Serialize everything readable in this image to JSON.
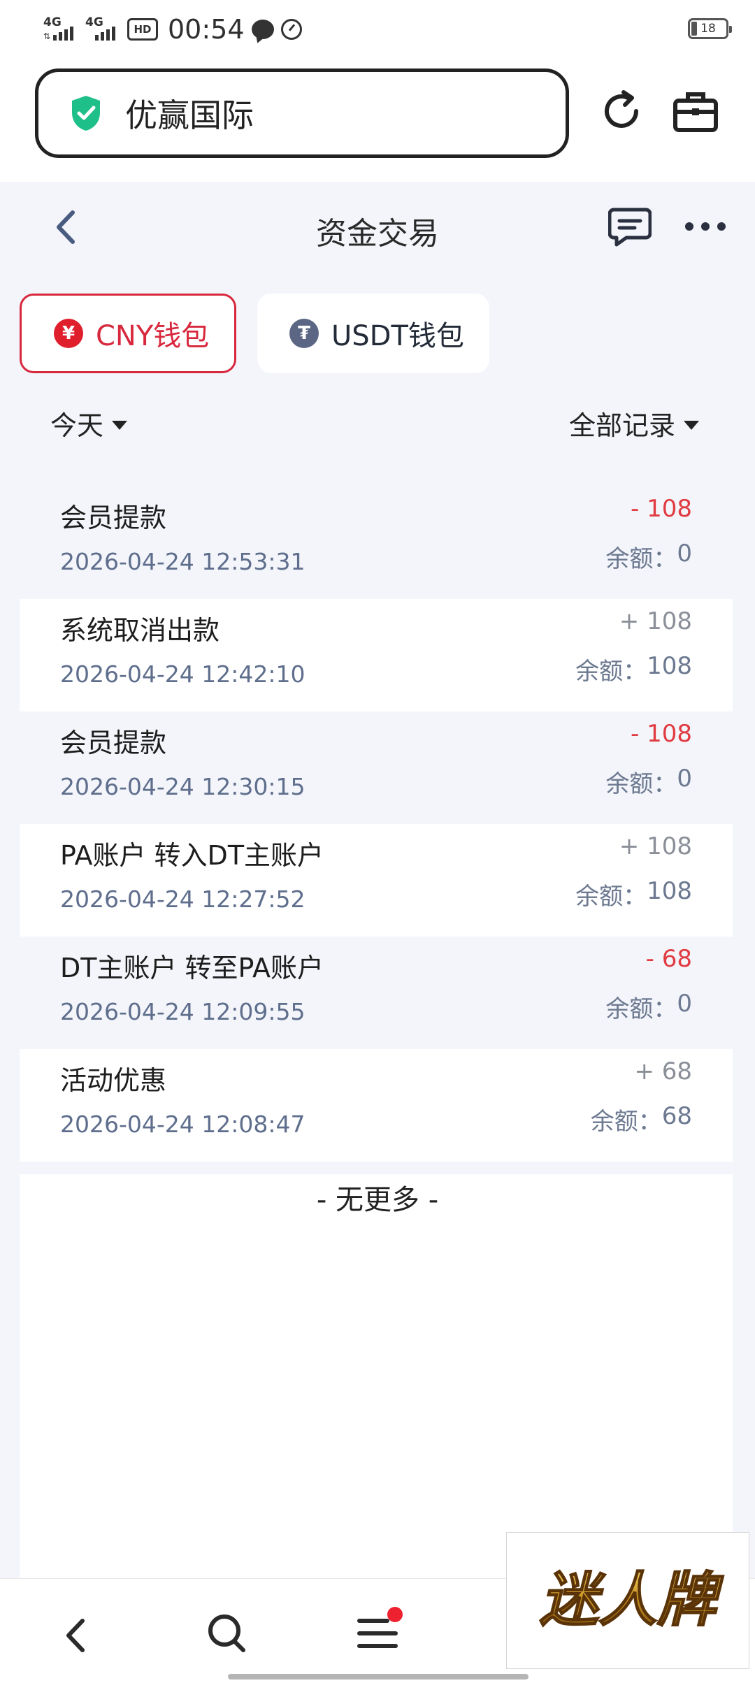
{
  "status_bar": {
    "signal1": "4G",
    "signal2": "4G",
    "hd": "HD",
    "time": "00:54",
    "battery": "18"
  },
  "browser": {
    "url_title": "优赢国际"
  },
  "header": {
    "title": "资金交易"
  },
  "wallet_tabs": [
    {
      "label": "CNY钱包",
      "coin_symbol": "¥",
      "active": true
    },
    {
      "label": "USDT钱包",
      "coin_symbol": "₮",
      "active": false
    }
  ],
  "filters": {
    "date": "今天",
    "type": "全部记录"
  },
  "balance_label": "余额：",
  "transactions": [
    {
      "name": "会员提款",
      "time": "2026-04-24 12:53:31",
      "amount": "- 108",
      "balance": "0",
      "sign": "neg"
    },
    {
      "name": "系统取消出款",
      "time": "2026-04-24 12:42:10",
      "amount": "+ 108",
      "balance": "108",
      "sign": "pos"
    },
    {
      "name": "会员提款",
      "time": "2026-04-24 12:30:15",
      "amount": "- 108",
      "balance": "0",
      "sign": "neg"
    },
    {
      "name": "PA账户 转入DT主账户",
      "time": "2026-04-24 12:27:52",
      "amount": "+ 108",
      "balance": "108",
      "sign": "pos"
    },
    {
      "name": "DT主账户 转至PA账户",
      "time": "2026-04-24 12:09:55",
      "amount": "- 68",
      "balance": "0",
      "sign": "neg"
    },
    {
      "name": "活动优惠",
      "time": "2026-04-24 12:08:47",
      "amount": "+ 68",
      "balance": "68",
      "sign": "pos"
    }
  ],
  "list_end": "- 无更多 -",
  "watermark": "迷人牌",
  "colors": {
    "accent_red": "#d8283d",
    "negative": "#e13b42",
    "positive": "#8b8f98",
    "shield_green": "#1fbf8a"
  }
}
